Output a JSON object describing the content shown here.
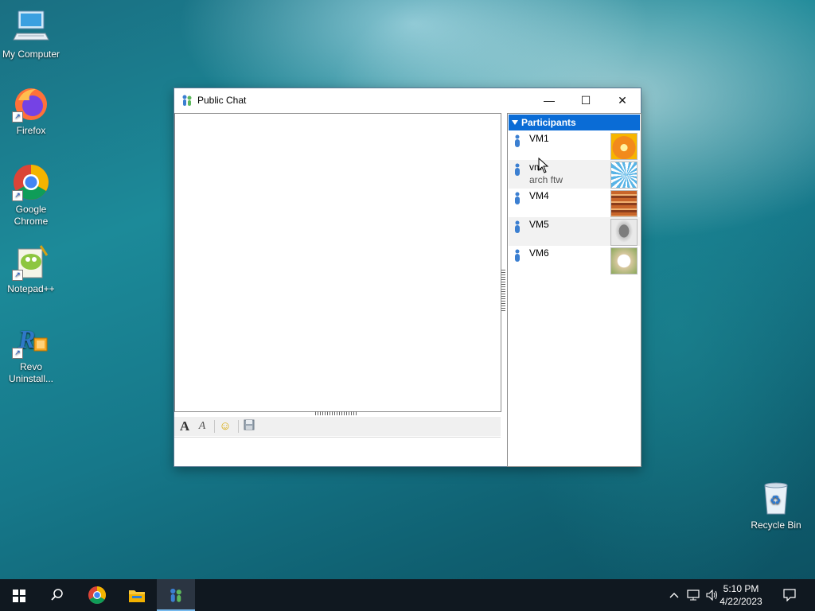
{
  "desktop": {
    "icons": [
      {
        "label": "My Computer",
        "icon": "computer-icon"
      },
      {
        "label": "Firefox",
        "icon": "firefox-icon"
      },
      {
        "label": "Google Chrome",
        "icon": "chrome-icon"
      },
      {
        "label": "Notepad++",
        "icon": "notepadpp-icon"
      },
      {
        "label": "Revo Uninstall...",
        "icon": "revo-uninstaller-icon"
      },
      {
        "label": "Recycle Bin",
        "icon": "recycle-bin-icon"
      }
    ]
  },
  "window": {
    "title": "Public Chat",
    "controls": {
      "minimize": "—",
      "maximize": "☐",
      "close": "✕"
    },
    "toolbar": {
      "font_glyph": "A",
      "font_style_glyph": "A",
      "emoji_glyph": "☺",
      "save_glyph": "💾"
    },
    "participants": {
      "header": "Participants",
      "items": [
        {
          "name": "VM1",
          "status": "",
          "avatar_color": "#f28a1c"
        },
        {
          "name": "vm",
          "status": "arch ftw",
          "avatar_color": "#59b4e6"
        },
        {
          "name": "VM4",
          "status": "",
          "avatar_color": "#a8542a"
        },
        {
          "name": "VM5",
          "status": "",
          "avatar_color": "#9d9d9d"
        },
        {
          "name": "VM6",
          "status": "",
          "avatar_color": "#d9c8a0"
        }
      ]
    }
  },
  "taskbar": {
    "clock_time": "5:10 PM",
    "clock_date": "4/22/2023",
    "accent": "#76b9ed"
  }
}
